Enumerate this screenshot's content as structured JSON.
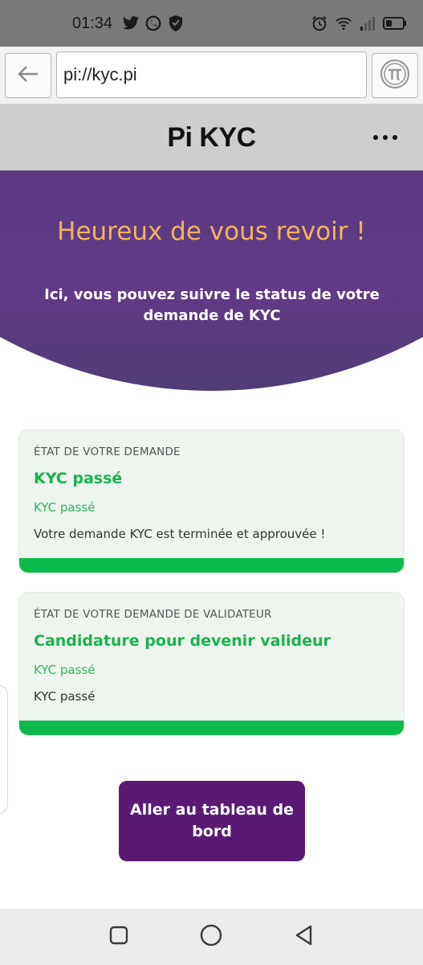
{
  "status_bar": {
    "time": "01:34",
    "left_icons": [
      "twitter-icon",
      "whatsapp-icon",
      "shield-icon"
    ],
    "right_icons": [
      "alarm-icon",
      "wifi-icon",
      "signal-icon",
      "battery-icon"
    ]
  },
  "browser": {
    "url": "pi://kyc.pi"
  },
  "app": {
    "title": "Pi KYC"
  },
  "hero": {
    "title": "Heureux de vous revoir !",
    "subtitle": "Ici, vous pouvez suivre le status de votre demande de KYC"
  },
  "cards": [
    {
      "overline": "ÉTAT DE VOTRE DEMANDE",
      "title": "KYC passé",
      "subtitle": "KYC passé",
      "description": "Votre demande KYC est terminée et approuvée !"
    },
    {
      "overline": "ÉTAT DE VOTRE DEMANDE DE VALIDATEUR",
      "title": "Candidature pour devenir valideur",
      "subtitle": "KYC passé",
      "description": "KYC passé"
    }
  ],
  "dashboard_button": {
    "label": "Aller au tableau de bord"
  },
  "colors": {
    "hero_purple": "#5b3a82",
    "hero_title": "#f5b25e",
    "status_green": "#19b34d",
    "bar_green": "#0cbb4c",
    "button_purple": "#5a1a74",
    "card_bg": "#eef4ee"
  }
}
